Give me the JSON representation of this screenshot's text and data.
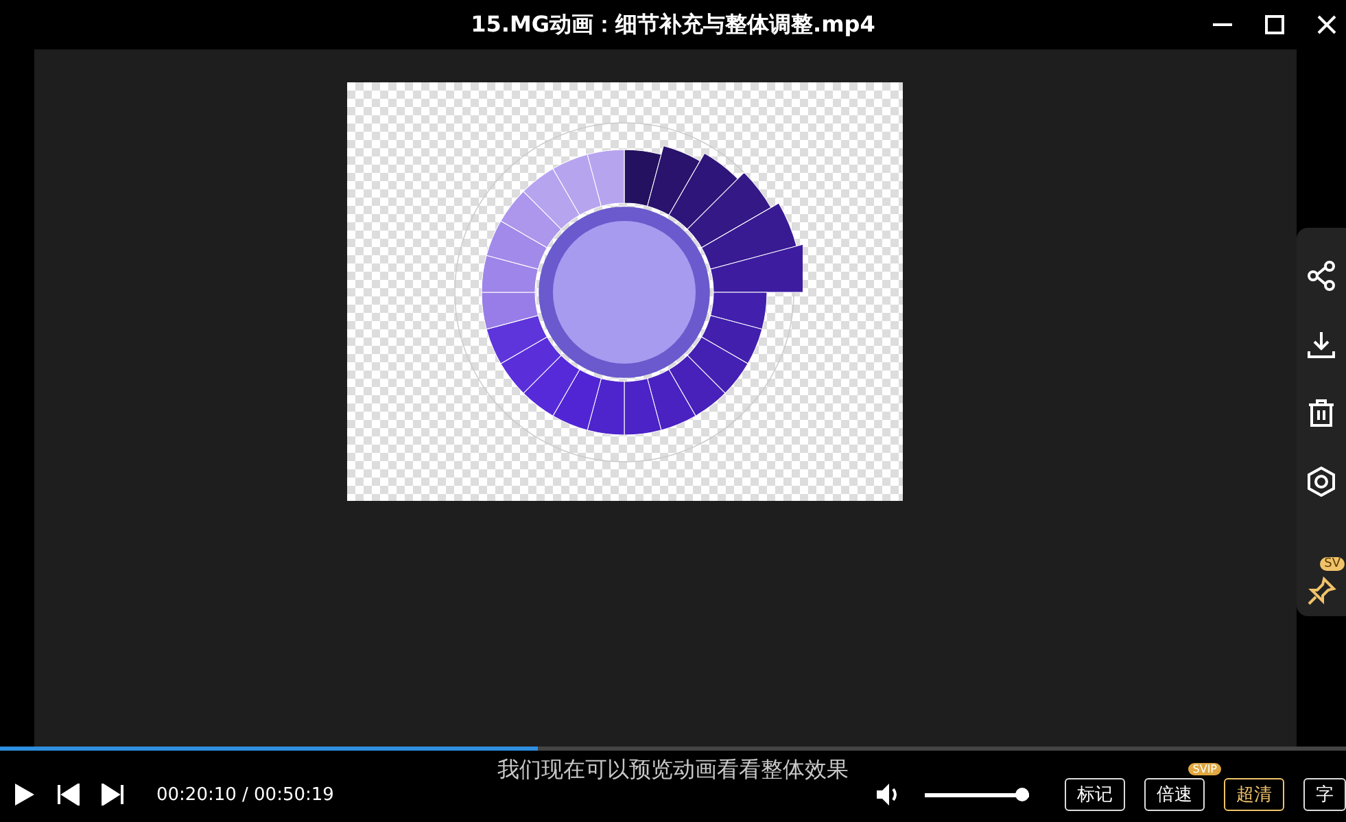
{
  "window": {
    "title": "15.MG动画：细节补充与整体调整.mp4"
  },
  "side_panel": {
    "pin_badge": "SV"
  },
  "player": {
    "subtitle": "我们现在可以预览动画看看整体效果",
    "progress": {
      "level": 0.4
    },
    "time": "00:20:10 / 00:50:19",
    "volume": {
      "level": 1.0
    },
    "buttons": [
      {
        "label": "标记",
        "selected": false
      },
      {
        "label": "倍速",
        "selected": false,
        "badge": "SVIP"
      },
      {
        "label": "超清",
        "selected": true
      },
      {
        "label": "字",
        "selected": false
      }
    ]
  }
}
